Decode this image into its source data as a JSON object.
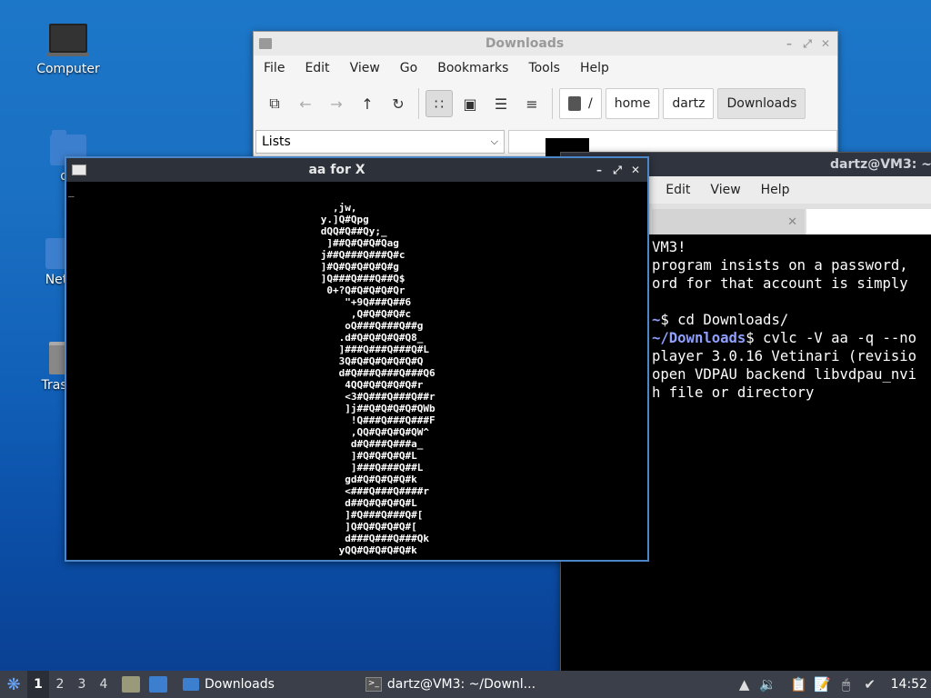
{
  "desktop": {
    "icons": [
      {
        "label": "Computer"
      },
      {
        "label": "da"
      },
      {
        "label": "Net"
      },
      {
        "label": "Trash"
      }
    ]
  },
  "file_manager": {
    "title": "Downloads",
    "menu": [
      "File",
      "Edit",
      "View",
      "Go",
      "Bookmarks",
      "Tools",
      "Help"
    ],
    "path_root": "/",
    "breadcrumbs": [
      "home",
      "dartz",
      "Downloads"
    ],
    "side_pane_value": "Lists"
  },
  "aa_window": {
    "title": "aa for X",
    "cursor": "_",
    "art": [
      "        ,jw,",
      "      y.]Q#Qpg",
      "      dQQ#Q##Qy;_",
      "       ]##Q#Q#Q#Qag",
      "      j##Q###Q###Q#c",
      "      ]#Q#Q#Q#Q#Q#g",
      "      ]Q###Q###Q##Q$",
      "       0+?Q#Q#Q#Q#Qr",
      "          \"+9Q###Q##6",
      "           ,Q#Q#Q#Q#c",
      "          oQ###Q###Q##g",
      "         .d#Q#Q#Q#Q#Q8_",
      "         ]###Q###Q###Q#L",
      "         3Q#Q#Q#Q#Q#Q#Q",
      "         d#Q###Q###Q###Q6",
      "          4QQ#Q#Q#Q#Q#r",
      "          <3#Q###Q###Q##r",
      "          ]j##Q#Q#Q#Q#QWb",
      "           !Q###Q###Q###F",
      "           ,QQ#Q#Q#Q#QW^",
      "           d#Q###Q###a_",
      "           ]#Q#Q#Q#Q#L",
      "           ]###Q###Q##L",
      "          gd#Q#Q#Q#Q#k",
      "          <###Q###Q####r",
      "          d##Q#Q#Q#Q#L",
      "          ]#Q###Q###Q#[",
      "          ]Q#Q#Q#Q#Q#[",
      "          d###Q###Q###Qk",
      "         yQQ#Q#Q#Q#Q#k"
    ]
  },
  "terminal": {
    "title": "dartz@VM3: ~",
    "menu": [
      "s",
      "Edit",
      "View",
      "Help"
    ],
    "lines": [
      {
        "prompt": "",
        "text": "VM3!"
      },
      {
        "prompt": "",
        "text": "program insists on a password,"
      },
      {
        "prompt": "",
        "text": "ord for that account is simply"
      },
      {
        "prompt": "",
        "text": ""
      },
      {
        "prompt": "~",
        "text": "$ cd Downloads/"
      },
      {
        "prompt": "~/Downloads",
        "text": "$ cvlc -V aa -q --no"
      },
      {
        "prompt": "",
        "text": "player 3.0.16 Vetinari (revisio"
      },
      {
        "prompt": "",
        "text": "open VDPAU backend libvdpau_nvi"
      },
      {
        "prompt": "",
        "text": "h file or directory"
      }
    ]
  },
  "taskbar": {
    "workspaces": [
      "1",
      "2",
      "3",
      "4"
    ],
    "tasks": [
      "Downloads",
      "dartz@VM3: ~/Downl..."
    ],
    "clock": "14:52"
  }
}
